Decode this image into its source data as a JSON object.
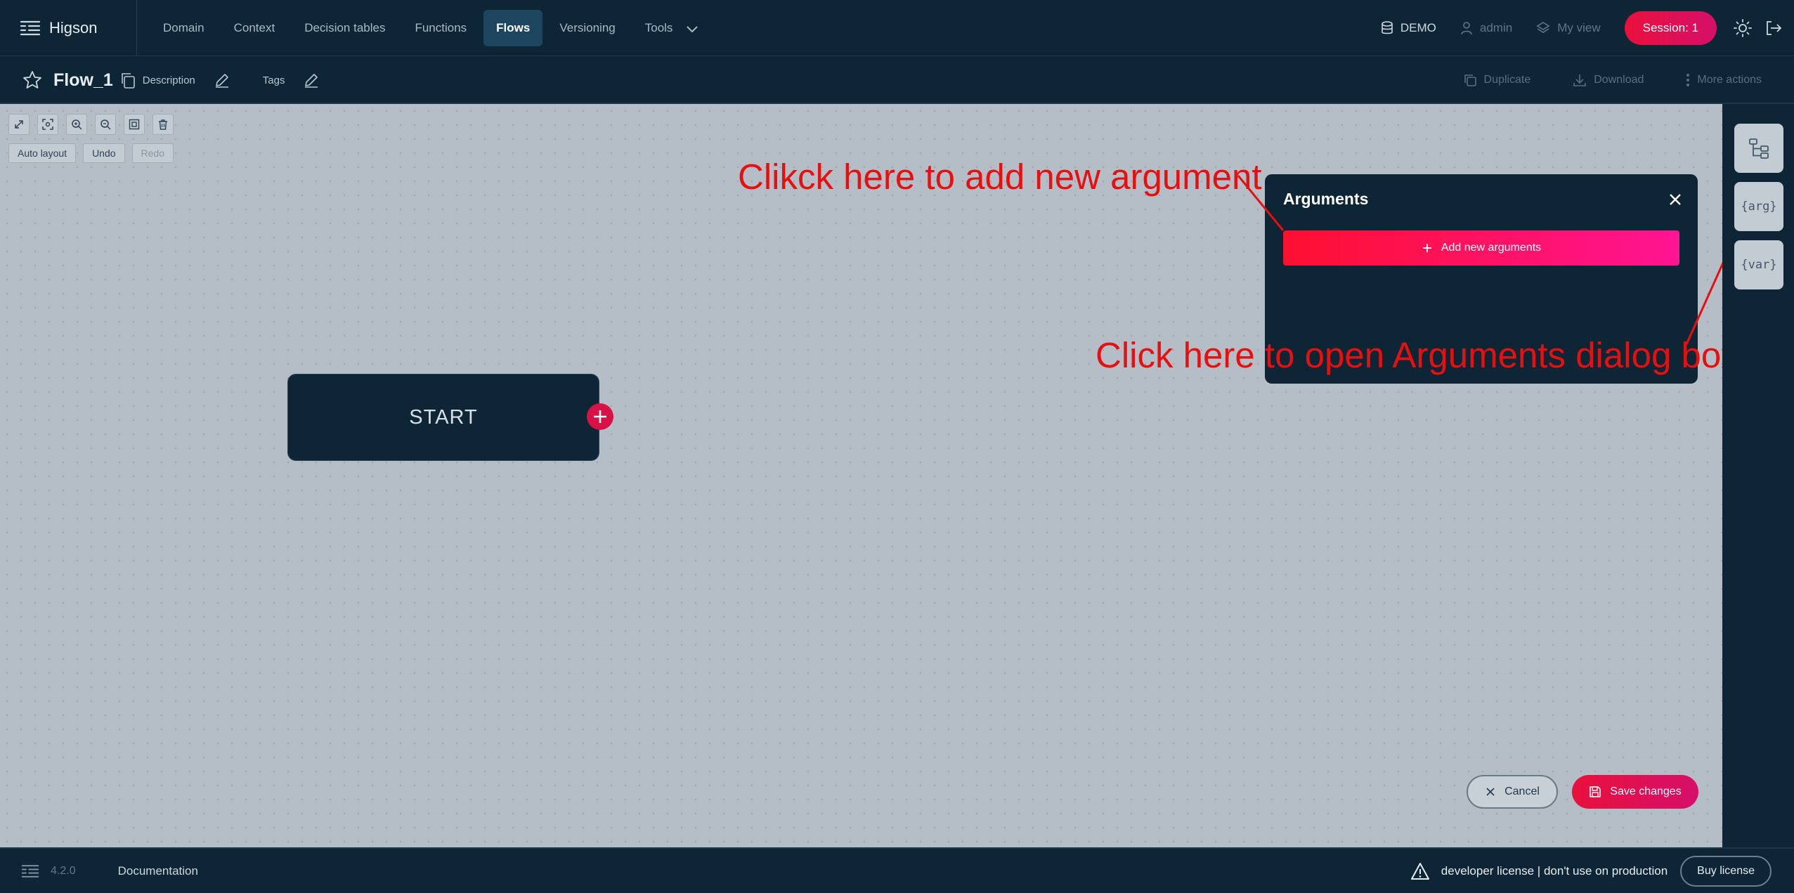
{
  "app": {
    "name": "Higson"
  },
  "nav": {
    "items": [
      {
        "label": "Domain"
      },
      {
        "label": "Context"
      },
      {
        "label": "Decision tables"
      },
      {
        "label": "Functions"
      },
      {
        "label": "Flows"
      },
      {
        "label": "Versioning"
      },
      {
        "label": "Tools"
      }
    ],
    "active": "Flows"
  },
  "topbar_right": {
    "environment": "DEMO",
    "user": "admin",
    "view": "My view",
    "session": "Session: 1"
  },
  "flow": {
    "name": "Flow_1",
    "description_label": "Description",
    "tags_label": "Tags",
    "actions": {
      "duplicate": "Duplicate",
      "download": "Download",
      "more": "More actions"
    }
  },
  "canvas_toolbar": {
    "icons": [
      "expand-icon",
      "fit-view-icon",
      "zoom-in-icon",
      "zoom-out-icon",
      "frame-icon",
      "trash-icon"
    ],
    "auto_layout": "Auto layout",
    "undo": "Undo",
    "redo": "Redo"
  },
  "nodes": {
    "start_label": "START"
  },
  "arguments_panel": {
    "title": "Arguments",
    "add_button": "Add new arguments"
  },
  "annotations": {
    "add_argument": "Clikck here to add new argument",
    "open_dialog": "Click here to open Arguments dialog box"
  },
  "right_rail": {
    "arg_label": "{arg}",
    "var_label": "{var}"
  },
  "bottom_actions": {
    "cancel": "Cancel",
    "save": "Save changes"
  },
  "footer": {
    "version": "4.2.0",
    "documentation": "Documentation",
    "license_text": "developer license | don't use on production",
    "buy_license": "Buy license"
  },
  "colors": {
    "navy": "#0d2535",
    "canvas": "#b5bdc6",
    "accent": "#e8103c",
    "accent_pink": "#ff1493",
    "annotation_red": "#e61010"
  }
}
